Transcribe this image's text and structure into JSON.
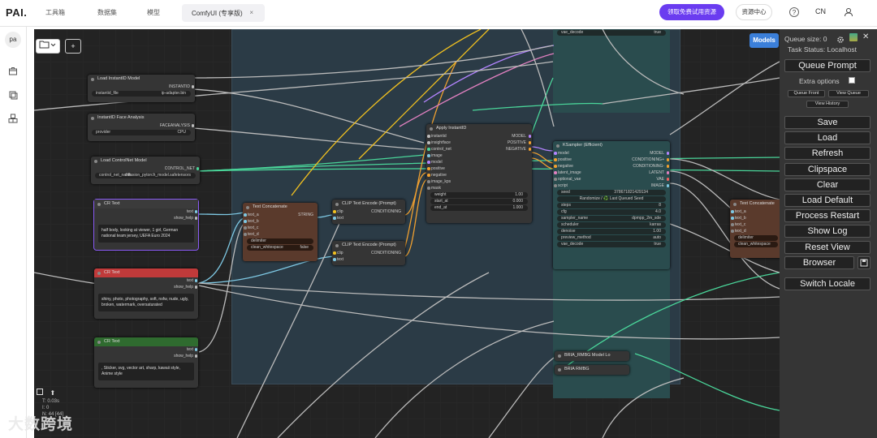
{
  "topbar": {
    "logo": "PAI.",
    "nav": [
      "工具箱",
      "数据集",
      "模型"
    ],
    "active_tab": "ComfyUI (专享版)",
    "promo_button": "领取免费试用资源",
    "resource_center": "资源中心",
    "help": "?",
    "language": "CN"
  },
  "leftbar": {
    "avatar": "pa"
  },
  "canvas": {
    "models_button": "Models",
    "nodes": {
      "load_instantid": {
        "title": "Load InstantID Model",
        "output": "INSTANTID",
        "widget_label": "instantid_file",
        "widget_value": "ip-adapter.bin"
      },
      "face_analysis": {
        "title": "InstantID Face Analysis",
        "output": "FACEANALYSIS",
        "widget_label": "provider",
        "widget_value": "CPU"
      },
      "load_controlnet": {
        "title": "Load ControlNet Model",
        "output": "CONTROL_NET",
        "widget_label": "control_net_name",
        "widget_value": "diffusion_pytorch_model.safetensors"
      },
      "cr_text_1": {
        "title": "CR Text",
        "outputs": [
          "text",
          "show_help"
        ],
        "text": "half body, looking at viewer, 1 girl, German national team jersey, UEFA Euro 2024"
      },
      "cr_text_2": {
        "title": "CR Text",
        "outputs": [
          "text",
          "show_help"
        ],
        "text": "shiny, photo, photography, soft, nsfw, nude, ugly, broken, watermark, oversaturated"
      },
      "cr_text_3": {
        "title": "CR Text",
        "outputs": [
          "text",
          "show_help"
        ],
        "text": ", Sticker, svg, vector art, sharp, kawaii style, Anime style"
      },
      "text_concat_1": {
        "title": "Text Concatenate",
        "inputs": [
          "text_a",
          "text_b",
          "text_c",
          "text_d"
        ],
        "output": "STRING",
        "delimiter": "delimiter",
        "clean_label": "clean_whitespace",
        "clean_value": "false"
      },
      "clip_encode_1": {
        "title": "CLIP Text Encode (Prompt)",
        "inputs": [
          "clip",
          "text"
        ],
        "output": "CONDITIONING"
      },
      "clip_encode_2": {
        "title": "CLIP Text Encode (Prompt)",
        "inputs": [
          "clip",
          "text"
        ],
        "output": "CONDITIONING"
      },
      "apply_instantid": {
        "title": "Apply InstantID",
        "inputs": [
          "instantid",
          "insightface",
          "control_net",
          "image",
          "model",
          "positive",
          "negative",
          "image_kps",
          "mask"
        ],
        "outputs": [
          "MODEL",
          "POSITIVE",
          "NEGATIVE"
        ],
        "widgets": [
          {
            "label": "weight",
            "value": "1.00"
          },
          {
            "label": "start_at",
            "value": "0.000"
          },
          {
            "label": "end_at",
            "value": "1.000"
          }
        ]
      },
      "ksampler": {
        "title": "KSampler (Efficient)",
        "inputs": [
          "model",
          "positive",
          "negative",
          "latent_image",
          "optional_vae",
          "script"
        ],
        "outputs": [
          "MODEL",
          "CONDITIONING+",
          "CONDITIONING-",
          "LATENT",
          "VAE",
          "IMAGE"
        ],
        "seed_label": "seed",
        "seed_value": "378671821429134",
        "randomize": "Randomize / ♻️ Last Queued Seed",
        "widgets": [
          {
            "label": "steps",
            "value": "8"
          },
          {
            "label": "cfg",
            "value": "4.0"
          },
          {
            "label": "sampler_name",
            "value": "dpmpp_2m_sde"
          },
          {
            "label": "scheduler",
            "value": "karras"
          },
          {
            "label": "denoise",
            "value": "1.00"
          },
          {
            "label": "preview_method",
            "value": "auto"
          },
          {
            "label": "vae_decode",
            "value": "true"
          }
        ],
        "top_widget_label": "vae_decode",
        "top_widget_value": "true"
      },
      "text_concat_2": {
        "title": "Text Concatenate",
        "inputs": [
          "text_a",
          "text_b",
          "text_c",
          "text_d"
        ],
        "delimiter": "delimiter",
        "clean_label": "clean_whitespace"
      },
      "bria_loader": {
        "title": "BRIA_RMBG Model Lo"
      },
      "bria_rmbg": {
        "title": "BRIA RMBG"
      }
    },
    "stats": [
      "T: 0.03s",
      "I: 0",
      "N: 44 [44]"
    ],
    "watermark": "大数跨境"
  },
  "panel": {
    "queue_size": "Queue size: 0",
    "task_status": "Task Status: Localhost",
    "queue_prompt": "Queue Prompt",
    "extra_options": "Extra options",
    "queue_front": "Queue Front",
    "view_queue": "View Queue",
    "view_history": "View History",
    "save": "Save",
    "load": "Load",
    "refresh": "Refresh",
    "clipspace": "Clipspace",
    "clear": "Clear",
    "load_default": "Load Default",
    "process_restart": "Process Restart",
    "show_log": "Show Log",
    "reset_view": "Reset View",
    "browser": "Browser",
    "switch_locale": "Switch Locale"
  },
  "colors": {
    "accent": "#6a3cf0",
    "models_btn": "#3b7fd9",
    "ksampler_body": "#2a4c4e",
    "group_bg": "#2b3b46",
    "cr_red": "#c03a3a",
    "cr_green": "#2f6b2f",
    "concat_brown": "#5a3a2c"
  }
}
